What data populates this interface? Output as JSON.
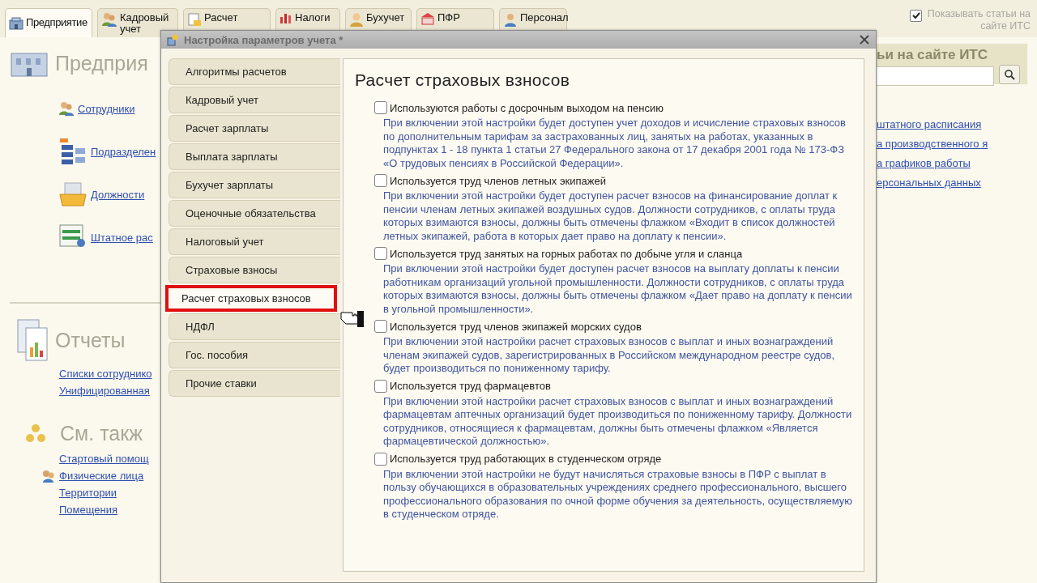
{
  "tabs": [
    {
      "label": "Предприятие",
      "selected": true
    },
    {
      "label": "Кадровый учет",
      "selected": false
    },
    {
      "label": "Расчет",
      "selected": false
    },
    {
      "label": "Налоги",
      "selected": false
    },
    {
      "label": "Бухучет",
      "selected": false
    },
    {
      "label": "ПФР",
      "selected": false
    },
    {
      "label": "Персонал",
      "selected": false
    }
  ],
  "show_its": {
    "label": "Показывать статьи на сайте ИТС",
    "checked": true
  },
  "left_panel": {
    "sections": [
      {
        "title": "Предприя",
        "links": [
          {
            "label": "Сотрудники"
          },
          {
            "label": "Подразделен"
          },
          {
            "label": "Должности"
          },
          {
            "label": "Штатное рас"
          }
        ]
      },
      {
        "title": "Отчеты",
        "links": [
          {
            "label": "Списки сотруднико"
          },
          {
            "label": "Унифицированная"
          }
        ]
      },
      {
        "title": "См. такж",
        "links": [
          {
            "label": "Стартовый помощ"
          },
          {
            "label": "Физические лица"
          },
          {
            "label": "Территории"
          },
          {
            "label": "Помещения"
          }
        ]
      }
    ]
  },
  "its_panel": {
    "title": "ьи на сайте ИТС",
    "links": [
      {
        "label": "штатного расписания"
      },
      {
        "label": "а производственного я"
      },
      {
        "label": "а графиков работы"
      },
      {
        "label": "ерсональных данных"
      }
    ]
  },
  "dialog": {
    "title": "Настройка параметров учета *",
    "nav": [
      {
        "label": "Алгоритмы расчетов",
        "selected": false
      },
      {
        "label": "Кадровый учет",
        "selected": false
      },
      {
        "label": "Расчет зарплаты",
        "selected": false
      },
      {
        "label": "Выплата зарплаты",
        "selected": false
      },
      {
        "label": "Бухучет зарплаты",
        "selected": false
      },
      {
        "label": "Оценочные обязательства",
        "selected": false
      },
      {
        "label": "Налоговый учет",
        "selected": false
      },
      {
        "label": "Страховые взносы",
        "selected": false
      },
      {
        "label": "Расчет страховых взносов",
        "selected": true
      },
      {
        "label": "НДФЛ",
        "selected": false
      },
      {
        "label": "Гос. пособия",
        "selected": false
      },
      {
        "label": "Прочие ставки",
        "selected": false
      }
    ],
    "heading": "Расчет страховых взносов",
    "options": [
      {
        "label": "Используются работы с досрочным выходом на пенсию",
        "checked": false,
        "description": "При включении этой настройки будет доступен учет доходов и исчисление страховых взносов по дополнительным тарифам за застрахованных лиц, занятых на работах, указанных в подпунктах 1 - 18 пункта 1 статьи 27 Федерального закона от 17 декабря 2001 года № 173-ФЗ «О трудовых пенсиях в Российской Федерации»."
      },
      {
        "label": "Используется труд членов летных экипажей",
        "checked": false,
        "description": "При включении этой настройки будет доступен расчет взносов на финансирование доплат к пенсии членам летных экипажей воздушных судов. Должности сотрудников, с оплаты труда которых взимаются взносы, должны быть отмечены флажком «Входит в список должностей летных экипажей, работа в которых дает право на доплату к пенсии»."
      },
      {
        "label": "Используется труд занятых на горных работах по добыче угля и сланца",
        "checked": false,
        "description": "При включении этой настройки будет доступен расчет взносов на выплату доплаты к пенсии работникам организаций угольной промышленности. Должности сотрудников, с оплаты труда которых взимаются взносы, должны быть отмечены флажком «Дает право на доплату к пенсии в угольной промышленности»."
      },
      {
        "label": "Используется труд членов экипажей морских судов",
        "checked": false,
        "description": "При включении этой настройки расчет страховых взносов с выплат и иных вознаграждений членам экипажей судов, зарегистрированных в Российском международном реестре судов, будет производиться по пониженному тарифу."
      },
      {
        "label": "Используется труд фармацевтов",
        "checked": false,
        "description": "При включении этой настройки расчет страховых взносов с выплат и иных вознаграждений фармацевтам аптечных организаций будет производиться по пониженному тарифу. Должности сотрудников, относящиеся к фармацевтам, должны быть отмечены флажком «Является фармацевтической должностью»."
      },
      {
        "label": "Используется труд работающих в студенческом отряде",
        "checked": false,
        "description": "При включении этой настройки не будут начисляться страховые взносы в ПФР с выплат в пользу обучающихся в образовательных учреждениях среднего профессионального, высшего профессионального образования по очной форме обучения за деятельность, осуществляемую в студенческом отряде."
      }
    ]
  }
}
